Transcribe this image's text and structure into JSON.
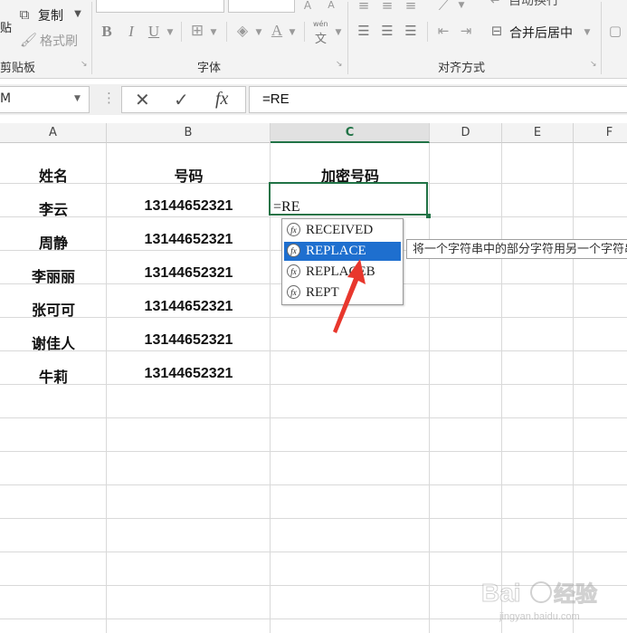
{
  "ribbon": {
    "paste_label": "贴",
    "copy_label": "复制",
    "format_painter_label": "格式刷",
    "clipboard_group": "剪贴板",
    "font_group": "字体",
    "align_group": "对齐方式",
    "merge_center_label": "合并后居中",
    "wrap_text_label": "自动换行",
    "bold": "B",
    "italic": "I",
    "underline": "U",
    "phonetic_top": "wén",
    "phonetic_bottom": "文"
  },
  "formula_bar": {
    "name_box": "M",
    "fx": "fx",
    "value": "=RE"
  },
  "columns": [
    "A",
    "B",
    "C",
    "D",
    "E",
    "F"
  ],
  "selected_column": "C",
  "sheet": {
    "header_a": "姓名",
    "header_b": "号码",
    "header_c": "加密号码",
    "rows": [
      {
        "name": "李云",
        "phone": "13144652321"
      },
      {
        "name": "周静",
        "phone": "13144652321"
      },
      {
        "name": "李丽丽",
        "phone": "13144652321"
      },
      {
        "name": "张可可",
        "phone": "13144652321"
      },
      {
        "name": "谢佳人",
        "phone": "13144652321"
      },
      {
        "name": "牛莉",
        "phone": "13144652321"
      }
    ],
    "active_cell_text": "=RE"
  },
  "autocomplete": {
    "items": [
      "RECEIVED",
      "REPLACE",
      "REPLACEB",
      "REPT"
    ],
    "highlighted": "REPLACE",
    "tooltip": "将一个字符串中的部分字符用另一个字符串替换"
  },
  "colors": {
    "excel_green": "#217346",
    "highlight_blue": "#1e6fcf",
    "arrow_red": "#e8372d"
  },
  "watermark": "Baidu经验 jingyan.baidu.com"
}
